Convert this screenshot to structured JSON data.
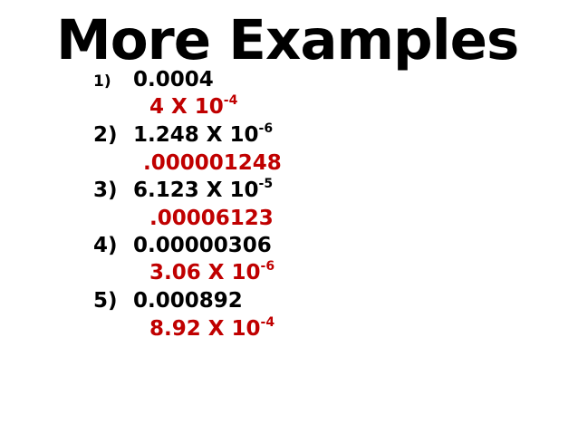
{
  "title": "More Examples",
  "examples": [
    {
      "number": "1)",
      "question": {
        "base": "0.0004",
        "exp": ""
      },
      "answer": {
        "base": "4 X 10",
        "exp": "-4"
      }
    },
    {
      "number": "2)",
      "question": {
        "base": "1.248 X 10",
        "exp": "-6"
      },
      "answer": {
        "base": ".000001248",
        "exp": ""
      }
    },
    {
      "number": "3)",
      "question": {
        "base": "6.123 X 10",
        "exp": "-5"
      },
      "answer": {
        "base": ".00006123",
        "exp": ""
      }
    },
    {
      "number": "4)",
      "question": {
        "base": "0.00000306",
        "exp": ""
      },
      "answer": {
        "base": "3.06 X 10",
        "exp": "-6"
      }
    },
    {
      "number": "5)",
      "question": {
        "base": "0.000892",
        "exp": ""
      },
      "answer": {
        "base": "8.92 X 10",
        "exp": "-4"
      }
    }
  ],
  "colors": {
    "question": "#000000",
    "answer": "#c00000",
    "background": "#ffffff"
  }
}
